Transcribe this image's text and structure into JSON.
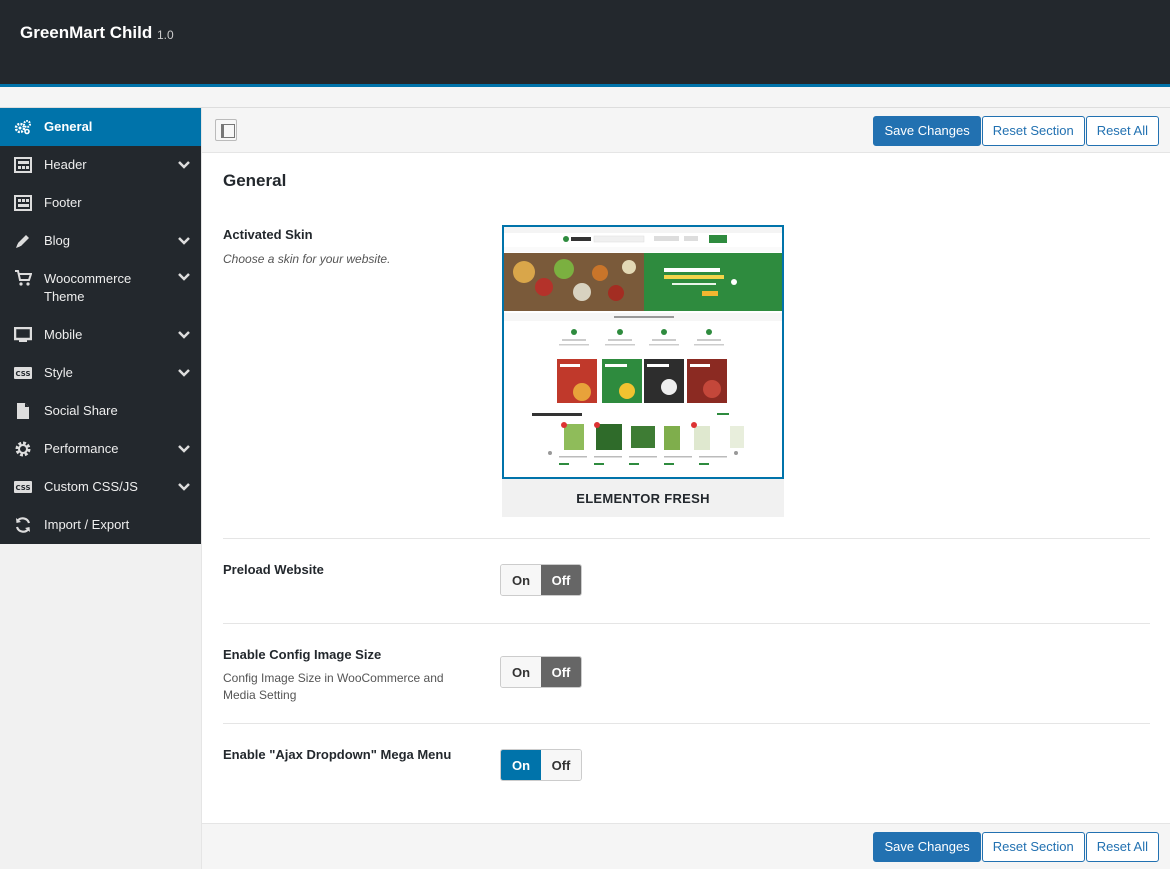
{
  "app": {
    "title": "GreenMart Child",
    "version": "1.0"
  },
  "sidebar": {
    "items": [
      {
        "label": "General",
        "icon": "gears-icon",
        "active": true,
        "has_children": false
      },
      {
        "label": "Header",
        "icon": "layout-icon",
        "active": false,
        "has_children": true
      },
      {
        "label": "Footer",
        "icon": "layout-icon",
        "active": false,
        "has_children": false
      },
      {
        "label": "Blog",
        "icon": "pencil-icon",
        "active": false,
        "has_children": true
      },
      {
        "label": "Woocommerce Theme",
        "icon": "cart-icon",
        "active": false,
        "has_children": true
      },
      {
        "label": "Mobile",
        "icon": "monitor-icon",
        "active": false,
        "has_children": true
      },
      {
        "label": "Style",
        "icon": "css-icon",
        "active": false,
        "has_children": true
      },
      {
        "label": "Social Share",
        "icon": "file-icon",
        "active": false,
        "has_children": false
      },
      {
        "label": "Performance",
        "icon": "gear-icon",
        "active": false,
        "has_children": true
      },
      {
        "label": "Custom CSS/JS",
        "icon": "css-icon",
        "active": false,
        "has_children": true
      },
      {
        "label": "Import / Export",
        "icon": "refresh-icon",
        "active": false,
        "has_children": false
      }
    ]
  },
  "toolbar": {
    "save_label": "Save Changes",
    "reset_section_label": "Reset Section",
    "reset_all_label": "Reset All"
  },
  "section": {
    "title": "General"
  },
  "fields": {
    "skin": {
      "label": "Activated Skin",
      "description": "Choose a skin for your website.",
      "skin_name": "ELEMENTOR FRESH"
    },
    "preload": {
      "label": "Preload Website",
      "on_label": "On",
      "off_label": "Off",
      "value": "off"
    },
    "config_image": {
      "label": "Enable Config Image Size",
      "description": "Config Image Size in WooCommerce and Media Setting",
      "on_label": "On",
      "off_label": "Off",
      "value": "off"
    },
    "ajax_menu": {
      "label": "Enable \"Ajax Dropdown\" Mega Menu",
      "on_label": "On",
      "off_label": "Off",
      "value": "on"
    }
  },
  "colors": {
    "accent": "#0073aa",
    "primary_button": "#2271b1",
    "dark": "#23282d",
    "thumb_green": "#2e8b3e"
  }
}
